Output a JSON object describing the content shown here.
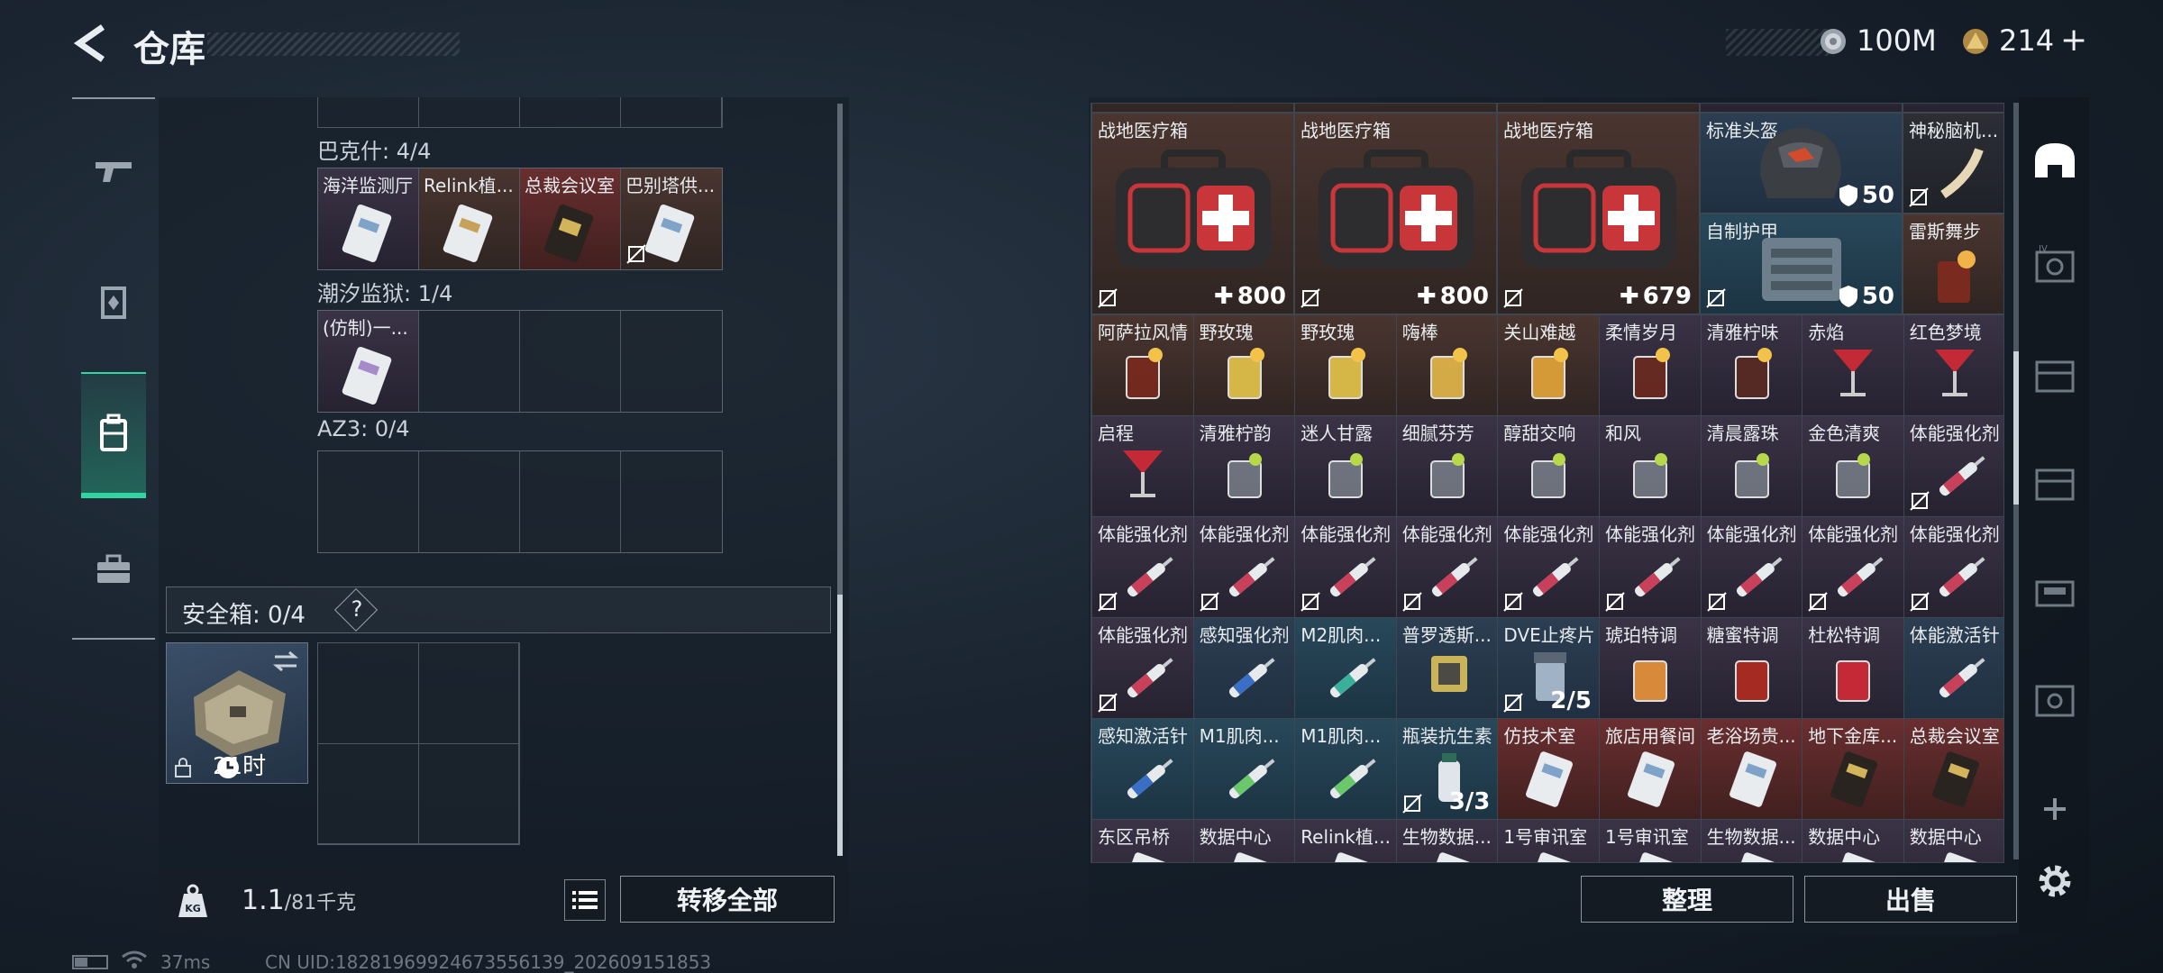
{
  "header": {
    "title": "仓库",
    "silver_value": "100M",
    "gold_value": "214",
    "add_label": "+"
  },
  "left": {
    "groups": [
      {
        "label": "巴克什: 4/4",
        "items": [
          "海洋监测厅",
          "Relink植...",
          "总裁会议室",
          "巴别塔供..."
        ]
      },
      {
        "label": "潮汐监狱: 1/4",
        "items": [
          "(仿制)一...",
          "",
          "",
          ""
        ]
      },
      {
        "label": "AZ3: 0/4",
        "items": [
          "",
          "",
          "",
          ""
        ]
      }
    ],
    "safe": {
      "label": "安全箱: 0/4",
      "help": "?",
      "timer": "21时"
    },
    "weight": {
      "value": "1.1",
      "capacity": "/81千克"
    },
    "transfer_label": "转移全部"
  },
  "inventory": {
    "large_items": [
      {
        "name": "战地医疗箱",
        "qty": "800"
      },
      {
        "name": "战地医疗箱",
        "qty": "800"
      },
      {
        "name": "战地医疗箱",
        "qty": "679"
      }
    ],
    "helmet": {
      "name": "标准头盔",
      "value": "50"
    },
    "armor": {
      "name": "自制护甲",
      "value": "50"
    },
    "small_top": [
      {
        "name": "神秘脑机..."
      },
      {
        "name": "雷斯舞步"
      }
    ],
    "rows": [
      [
        "阿萨拉风情",
        "野玫瑰",
        "野玫瑰",
        "嗨棒",
        "关山难越",
        "柔情岁月",
        "清雅柠味",
        "赤焰",
        "红色梦境"
      ],
      [
        "启程",
        "清雅柠韵",
        "迷人甘露",
        "细腻芬芳",
        "醇甜交响",
        "和风",
        "清晨露珠",
        "金色清爽",
        "体能强化剂"
      ],
      [
        "体能强化剂",
        "体能强化剂",
        "体能强化剂",
        "体能强化剂",
        "体能强化剂",
        "体能强化剂",
        "体能强化剂",
        "体能强化剂",
        "体能强化剂"
      ],
      [
        "体能强化剂",
        "感知强化剂",
        "M2肌肉...",
        "普罗透斯...",
        "DVE止疼片",
        "琥珀特调",
        "糖蜜特调",
        "杜松特调",
        "体能激活针"
      ],
      [
        "感知激活针",
        "M1肌肉...",
        "M1肌肉...",
        "瓶装抗生素",
        "仿技术室",
        "旅店用餐间",
        "老浴场贵...",
        "地下金库...",
        "总裁会议室"
      ],
      [
        "东区吊桥",
        "数据中心",
        "Relink植...",
        "生物数据...",
        "1号审讯室",
        "1号审讯室",
        "生物数据...",
        "数据中心",
        "数据中心"
      ]
    ],
    "qty_dve": "2/5",
    "qty_antibiotic": "3/3"
  },
  "actions": {
    "organize": "整理",
    "sell": "出售"
  },
  "status": {
    "ping": "37ms",
    "uid": "CN UID:1828196992467355613​9_202609151853"
  }
}
